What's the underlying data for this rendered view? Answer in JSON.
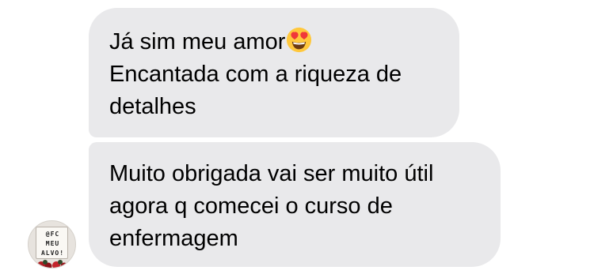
{
  "messages": [
    {
      "lines": [
        "Já sim meu amor",
        "Encantada com a riqueza de",
        "detalhes"
      ],
      "trailing_emoji": "heart-eyes-emoji"
    },
    {
      "lines": [
        "Muito obrigada vai ser muito útil",
        "agora q comecei o curso de",
        "enfermagem"
      ]
    }
  ],
  "avatar": {
    "sign_lines": [
      "@FC",
      "MEU",
      "ALVO!"
    ]
  },
  "colors": {
    "bubble_background": "#e9e9eb",
    "text": "#000000",
    "emoji_face": "#ffc83d",
    "emoji_heart": "#f0373a"
  }
}
